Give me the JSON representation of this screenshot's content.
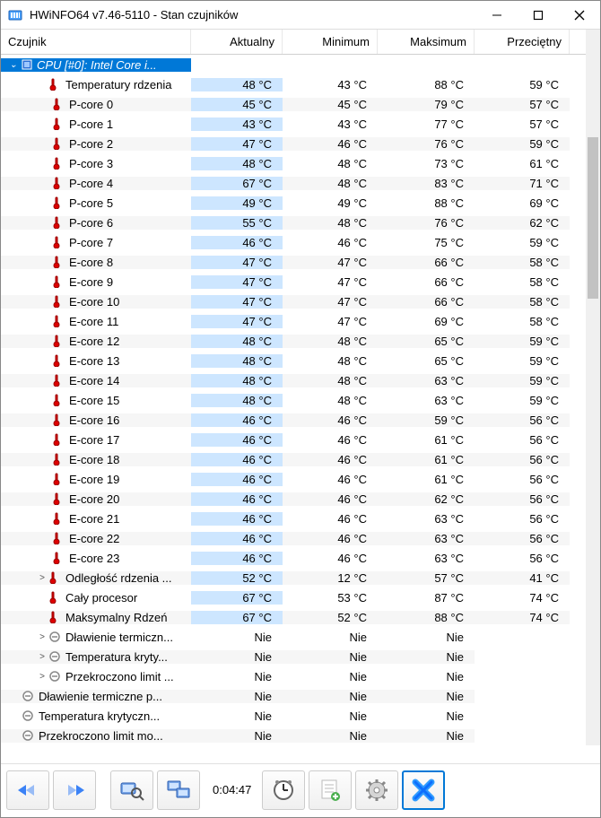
{
  "window": {
    "title": "HWiNFO64 v7.46-5110 - Stan czujników"
  },
  "columns": {
    "c0": "Czujnik",
    "c1": "Aktualny",
    "c2": "Minimum",
    "c3": "Maksimum",
    "c4": "Przeciętny"
  },
  "cpu_header": "CPU [#0]: Intel Core i...",
  "rows": [
    {
      "label": "Temperatury rdzenia",
      "cur": "48 °C",
      "min": "43 °C",
      "max": "88 °C",
      "avg": "59 °C",
      "indent": 2,
      "icon": "therm"
    },
    {
      "label": "P-core 0",
      "cur": "45 °C",
      "min": "45 °C",
      "max": "79 °C",
      "avg": "57 °C",
      "indent": 3,
      "icon": "therm"
    },
    {
      "label": "P-core 1",
      "cur": "43 °C",
      "min": "43 °C",
      "max": "77 °C",
      "avg": "57 °C",
      "indent": 3,
      "icon": "therm"
    },
    {
      "label": "P-core 2",
      "cur": "47 °C",
      "min": "46 °C",
      "max": "76 °C",
      "avg": "59 °C",
      "indent": 3,
      "icon": "therm"
    },
    {
      "label": "P-core 3",
      "cur": "48 °C",
      "min": "48 °C",
      "max": "73 °C",
      "avg": "61 °C",
      "indent": 3,
      "icon": "therm"
    },
    {
      "label": "P-core 4",
      "cur": "67 °C",
      "min": "48 °C",
      "max": "83 °C",
      "avg": "71 °C",
      "indent": 3,
      "icon": "therm"
    },
    {
      "label": "P-core 5",
      "cur": "49 °C",
      "min": "49 °C",
      "max": "88 °C",
      "avg": "69 °C",
      "indent": 3,
      "icon": "therm"
    },
    {
      "label": "P-core 6",
      "cur": "55 °C",
      "min": "48 °C",
      "max": "76 °C",
      "avg": "62 °C",
      "indent": 3,
      "icon": "therm"
    },
    {
      "label": "P-core 7",
      "cur": "46 °C",
      "min": "46 °C",
      "max": "75 °C",
      "avg": "59 °C",
      "indent": 3,
      "icon": "therm"
    },
    {
      "label": "E-core 8",
      "cur": "47 °C",
      "min": "47 °C",
      "max": "66 °C",
      "avg": "58 °C",
      "indent": 3,
      "icon": "therm"
    },
    {
      "label": "E-core 9",
      "cur": "47 °C",
      "min": "47 °C",
      "max": "66 °C",
      "avg": "58 °C",
      "indent": 3,
      "icon": "therm"
    },
    {
      "label": "E-core 10",
      "cur": "47 °C",
      "min": "47 °C",
      "max": "66 °C",
      "avg": "58 °C",
      "indent": 3,
      "icon": "therm"
    },
    {
      "label": "E-core 11",
      "cur": "47 °C",
      "min": "47 °C",
      "max": "69 °C",
      "avg": "58 °C",
      "indent": 3,
      "icon": "therm"
    },
    {
      "label": "E-core 12",
      "cur": "48 °C",
      "min": "48 °C",
      "max": "65 °C",
      "avg": "59 °C",
      "indent": 3,
      "icon": "therm"
    },
    {
      "label": "E-core 13",
      "cur": "48 °C",
      "min": "48 °C",
      "max": "65 °C",
      "avg": "59 °C",
      "indent": 3,
      "icon": "therm"
    },
    {
      "label": "E-core 14",
      "cur": "48 °C",
      "min": "48 °C",
      "max": "63 °C",
      "avg": "59 °C",
      "indent": 3,
      "icon": "therm"
    },
    {
      "label": "E-core 15",
      "cur": "48 °C",
      "min": "48 °C",
      "max": "63 °C",
      "avg": "59 °C",
      "indent": 3,
      "icon": "therm"
    },
    {
      "label": "E-core 16",
      "cur": "46 °C",
      "min": "46 °C",
      "max": "59 °C",
      "avg": "56 °C",
      "indent": 3,
      "icon": "therm"
    },
    {
      "label": "E-core 17",
      "cur": "46 °C",
      "min": "46 °C",
      "max": "61 °C",
      "avg": "56 °C",
      "indent": 3,
      "icon": "therm"
    },
    {
      "label": "E-core 18",
      "cur": "46 °C",
      "min": "46 °C",
      "max": "61 °C",
      "avg": "56 °C",
      "indent": 3,
      "icon": "therm"
    },
    {
      "label": "E-core 19",
      "cur": "46 °C",
      "min": "46 °C",
      "max": "61 °C",
      "avg": "56 °C",
      "indent": 3,
      "icon": "therm"
    },
    {
      "label": "E-core 20",
      "cur": "46 °C",
      "min": "46 °C",
      "max": "62 °C",
      "avg": "56 °C",
      "indent": 3,
      "icon": "therm"
    },
    {
      "label": "E-core 21",
      "cur": "46 °C",
      "min": "46 °C",
      "max": "63 °C",
      "avg": "56 °C",
      "indent": 3,
      "icon": "therm"
    },
    {
      "label": "E-core 22",
      "cur": "46 °C",
      "min": "46 °C",
      "max": "63 °C",
      "avg": "56 °C",
      "indent": 3,
      "icon": "therm"
    },
    {
      "label": "E-core 23",
      "cur": "46 °C",
      "min": "46 °C",
      "max": "63 °C",
      "avg": "56 °C",
      "indent": 3,
      "icon": "therm"
    },
    {
      "label": "Odległość rdzenia ...",
      "cur": "52 °C",
      "min": "12 °C",
      "max": "57 °C",
      "avg": "41 °C",
      "indent": 2,
      "icon": "therm",
      "expander": ">"
    },
    {
      "label": "Cały procesor",
      "cur": "67 °C",
      "min": "53 °C",
      "max": "87 °C",
      "avg": "74 °C",
      "indent": 2,
      "icon": "therm"
    },
    {
      "label": "Maksymalny Rdzeń",
      "cur": "67 °C",
      "min": "52 °C",
      "max": "88 °C",
      "avg": "74 °C",
      "indent": 2,
      "icon": "therm"
    },
    {
      "label": "Dławienie termiczn...",
      "cur": "Nie",
      "min": "Nie",
      "max": "Nie",
      "avg": "",
      "indent": 2,
      "icon": "circle",
      "expander": ">"
    },
    {
      "label": "Temperatura kryty...",
      "cur": "Nie",
      "min": "Nie",
      "max": "Nie",
      "avg": "",
      "indent": 2,
      "icon": "circle",
      "expander": ">"
    },
    {
      "label": "Przekroczono limit ...",
      "cur": "Nie",
      "min": "Nie",
      "max": "Nie",
      "avg": "",
      "indent": 2,
      "icon": "circle",
      "expander": ">"
    },
    {
      "label": "Dławienie termiczne p...",
      "cur": "Nie",
      "min": "Nie",
      "max": "Nie",
      "avg": "",
      "indent": 1,
      "icon": "circle"
    },
    {
      "label": "Temperatura krytyczn...",
      "cur": "Nie",
      "min": "Nie",
      "max": "Nie",
      "avg": "",
      "indent": 1,
      "icon": "circle"
    },
    {
      "label": "Przekroczono limit mo...",
      "cur": "Nie",
      "min": "Nie",
      "max": "Nie",
      "avg": "",
      "indent": 1,
      "icon": "circle"
    }
  ],
  "toolbar": {
    "elapsed": "0:04:47"
  }
}
